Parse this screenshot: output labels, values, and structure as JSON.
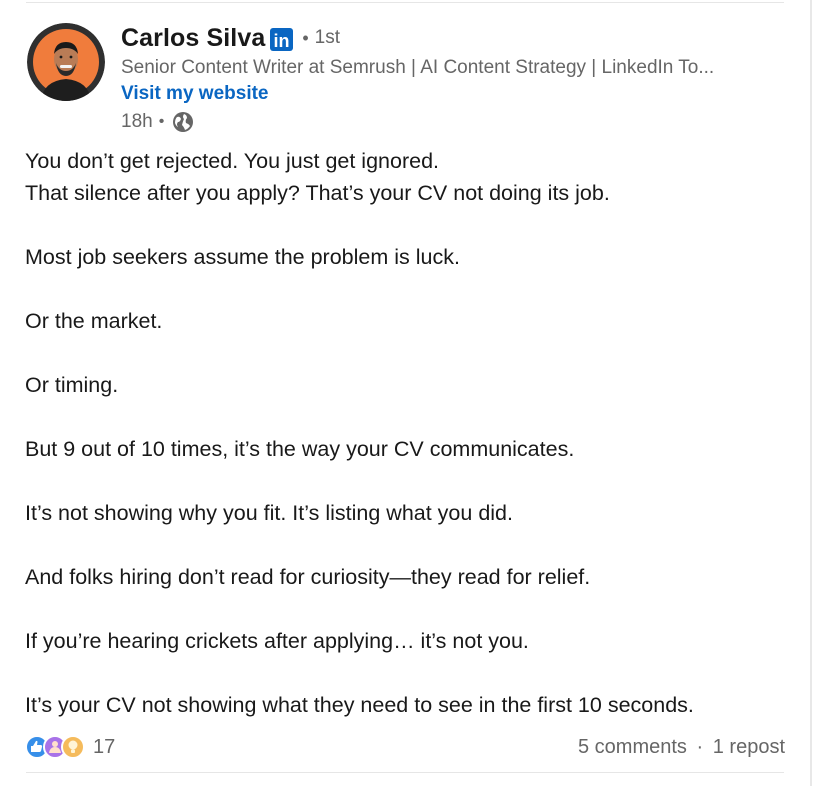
{
  "author": {
    "name": "Carlos Silva",
    "degree": "1st",
    "headline": "Senior Content Writer at Semrush | AI Content Strategy | LinkedIn To...",
    "website_link": "Visit my website",
    "timestamp": "18h",
    "visibility_icon": "globe-icon",
    "badge_icon": "linkedin-icon",
    "badge_text": "in"
  },
  "post": {
    "paragraphs": [
      [
        "You don’t get rejected. You just get ignored.",
        "That silence after you apply? That’s your CV not doing its job."
      ],
      [
        "Most job seekers assume the problem is luck."
      ],
      [
        "Or the market."
      ],
      [
        "Or timing."
      ],
      [
        "But 9 out of 10 times, it’s the way your CV communicates."
      ],
      [
        "It’s not showing why you fit. It’s listing what you did."
      ],
      [
        "And folks hiring don’t read for curiosity—they read for relief."
      ],
      [
        "If you’re hearing crickets after applying… it’s not you."
      ],
      [
        "It’s your CV not showing what they need to see in the first 10 seconds."
      ]
    ]
  },
  "social": {
    "reaction_icons": [
      "like-icon",
      "support-icon",
      "insightful-icon"
    ],
    "reaction_count": "17",
    "comments": "5 comments",
    "separator": "·",
    "reposts": "1 repost"
  },
  "colors": {
    "link_blue": "#0a66c2",
    "secondary_text": "#666666",
    "primary_text": "#191919",
    "avatar_bg": "#f07c3c"
  }
}
